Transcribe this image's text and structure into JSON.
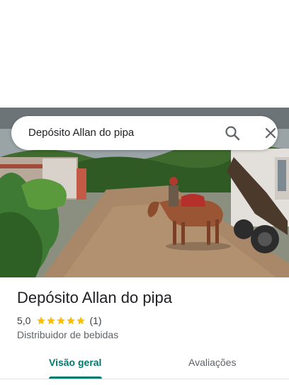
{
  "search": {
    "query": "Depósito Allan do pipa",
    "search_icon": "search-icon",
    "close_icon": "close-icon"
  },
  "place": {
    "name": "Depósito Allan do pipa",
    "rating": "5,0",
    "rating_value": 5.0,
    "stars_max": 5,
    "review_count": "(1)",
    "category": "Distribuidor de bebidas",
    "photo": "street-with-donkey-photo"
  },
  "tabs": [
    {
      "label": "Visão geral",
      "active": true
    },
    {
      "label": "Avaliações",
      "active": false
    }
  ],
  "colors": {
    "accent": "#00796b",
    "star": "#fbbc04",
    "text_secondary": "#5f6368"
  }
}
